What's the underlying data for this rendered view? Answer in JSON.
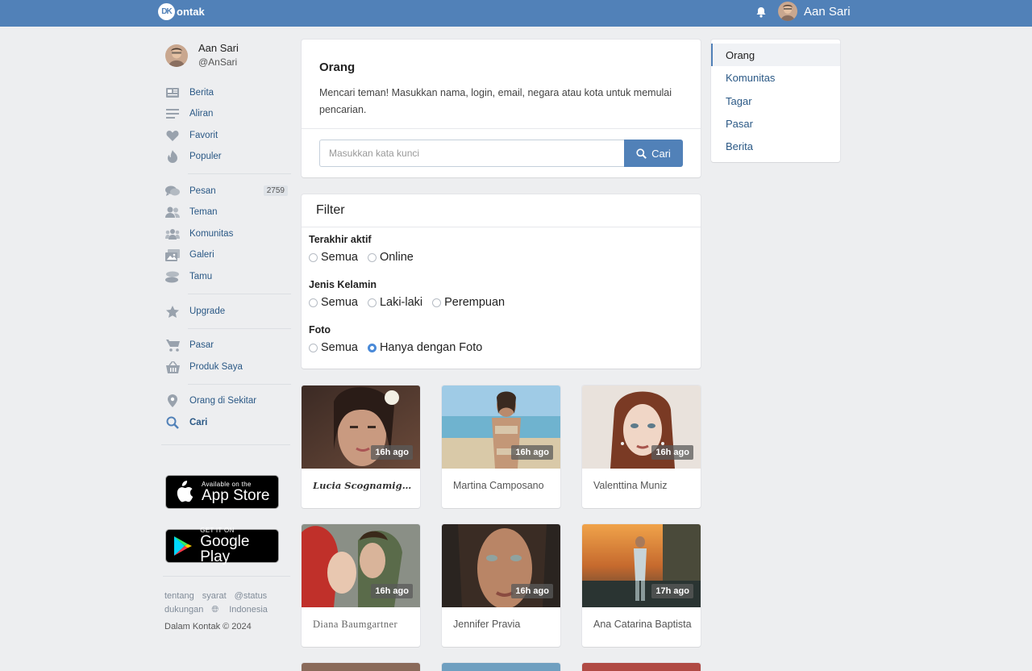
{
  "header": {
    "logo_mark": "DK",
    "logo_text": "ontak",
    "username": "Aan Sari"
  },
  "profile": {
    "name": "Aan Sari",
    "handle": "@AnSari"
  },
  "nav": {
    "berita": "Berita",
    "aliran": "Aliran",
    "favorit": "Favorit",
    "populer": "Populer",
    "pesan": "Pesan",
    "pesan_badge": "2759",
    "teman": "Teman",
    "komunitas": "Komunitas",
    "galeri": "Galeri",
    "tamu": "Tamu",
    "upgrade": "Upgrade",
    "pasar": "Pasar",
    "produk_saya": "Produk Saya",
    "orang_sekitar": "Orang di Sekitar",
    "cari": "Cari"
  },
  "stores": {
    "apple_small": "Available on the",
    "apple_big": "App Store",
    "google_small": "GET IT ON",
    "google_big": "Google Play"
  },
  "footer": {
    "tentang": "tentang",
    "syarat": "syarat",
    "status": "@status",
    "dukungan": "dukungan",
    "language": "Indonesia",
    "copyright": "Dalam Kontak © 2024"
  },
  "search": {
    "title": "Orang",
    "description": "Mencari teman! Masukkan nama, login, email, negara atau kota untuk memulai pencarian.",
    "placeholder": "Masukkan kata kunci",
    "value": "",
    "button": "Cari"
  },
  "filter": {
    "title": "Filter",
    "groups": [
      {
        "label": "Terakhir aktif",
        "options": [
          "Semua",
          "Online"
        ],
        "selected": null
      },
      {
        "label": "Jenis Kelamin",
        "options": [
          "Semua",
          "Laki-laki",
          "Perempuan"
        ],
        "selected": null
      },
      {
        "label": "Foto",
        "options": [
          "Semua",
          "Hanya dengan Foto"
        ],
        "selected": "Hanya dengan Foto"
      }
    ]
  },
  "right_nav": {
    "items": [
      "Orang",
      "Komunitas",
      "Tagar",
      "Pasar",
      "Berita"
    ],
    "active": "Orang"
  },
  "people": [
    {
      "name": "Lucia Scognamiglio",
      "time": "16h ago"
    },
    {
      "name": "Martina Camposano",
      "time": "16h ago"
    },
    {
      "name": "Valenttina Muniz",
      "time": "16h ago"
    },
    {
      "name": "Diana Baumgartner",
      "time": "16h ago"
    },
    {
      "name": "Jennifer Pravia",
      "time": "16h ago"
    },
    {
      "name": "Ana Catarina Baptista",
      "time": "17h ago"
    }
  ],
  "colors": {
    "brand": "#5181b8",
    "link": "#2a5885",
    "background": "#edeef0"
  }
}
